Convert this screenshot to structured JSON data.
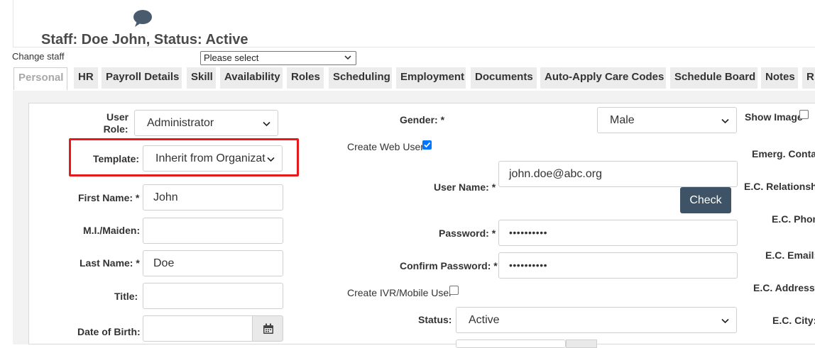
{
  "header": {
    "staff_title": "Staff: Doe John, Status: Active",
    "change_staff_label": "Change staff",
    "change_staff_select": "Please select"
  },
  "tabs": [
    {
      "label": "Personal",
      "active": true
    },
    {
      "label": "HR"
    },
    {
      "label": "Payroll Details"
    },
    {
      "label": "Skill"
    },
    {
      "label": "Availability"
    },
    {
      "label": "Roles"
    },
    {
      "label": "Scheduling"
    },
    {
      "label": "Employment"
    },
    {
      "label": "Documents"
    },
    {
      "label": "Auto-Apply Care Codes"
    },
    {
      "label": "Schedule Board"
    },
    {
      "label": "Notes"
    },
    {
      "label": "R"
    }
  ],
  "form": {
    "user_role": {
      "label_line1": "User",
      "label_line2": "Role:",
      "value": "Administrator"
    },
    "template": {
      "label": "Template:",
      "value": "Inherit from Organizat"
    },
    "first_name": {
      "label": "First Name: *",
      "value": "John"
    },
    "mi_maiden": {
      "label": "M.I./Maiden:",
      "value": ""
    },
    "last_name": {
      "label": "Last Name: *",
      "value": "Doe"
    },
    "title": {
      "label": "Title:",
      "value": ""
    },
    "date_of_birth": {
      "label": "Date of Birth:",
      "value": ""
    },
    "gender": {
      "label": "Gender: *",
      "value": "Male"
    },
    "create_web_user": {
      "label": "Create Web User",
      "checked": true
    },
    "user_name": {
      "label": "User Name: *",
      "value": "john.doe@abc.org"
    },
    "check_button": "Check",
    "password": {
      "label": "Password: *",
      "value": "••••••••••"
    },
    "confirm_password": {
      "label": "Confirm Password: *",
      "value": "••••••••••"
    },
    "create_ivr_user": {
      "label": "Create IVR/Mobile User",
      "checked": false
    },
    "status": {
      "label": "Status:",
      "value": "Active"
    }
  },
  "right_column": {
    "show_image": "Show Image",
    "emerg_contact": "Emerg. Conta",
    "ec_relationship": "E.C. Relationshi",
    "ec_phone": "E.C. Phon",
    "ec_email": "E.C. Email:",
    "ec_address": "E.C. Address:",
    "ec_city": "E.C. City:"
  },
  "colors": {
    "highlight": "#e8191c",
    "check_button": "#3e5366",
    "checkbox": "#0075ff"
  }
}
